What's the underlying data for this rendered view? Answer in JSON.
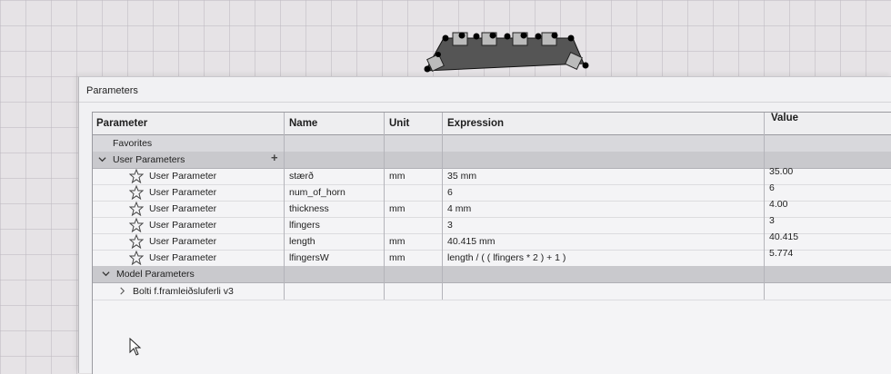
{
  "dialog": {
    "title": "Parameters"
  },
  "columns": {
    "parameter": "Parameter",
    "name": "Name",
    "unit": "Unit",
    "expression": "Expression",
    "value": "Value"
  },
  "favorites": {
    "label": "Favorites"
  },
  "user_parameters": {
    "label": "User Parameters",
    "add_icon": "plus-icon",
    "rows": [
      {
        "type": "User Parameter",
        "name": "stærð",
        "unit": "mm",
        "expression": "35 mm",
        "value": "35.00"
      },
      {
        "type": "User Parameter",
        "name": "num_of_horn",
        "unit": "",
        "expression": "6",
        "value": "6"
      },
      {
        "type": "User Parameter",
        "name": "thickness",
        "unit": "mm",
        "expression": "4 mm",
        "value": "4.00"
      },
      {
        "type": "User Parameter",
        "name": "lfingers",
        "unit": "",
        "expression": "3",
        "value": "3"
      },
      {
        "type": "User Parameter",
        "name": "length",
        "unit": "mm",
        "expression": "40.415 mm",
        "value": "40.415"
      },
      {
        "type": "User Parameter",
        "name": "lfingersW",
        "unit": "mm",
        "expression": "length / ( ( lfingers * 2 ) + 1 )",
        "value": "5.774"
      }
    ]
  },
  "model_parameters": {
    "label": "Model Parameters",
    "children": [
      {
        "label": "Bolti f.framleiðsluferli v3"
      }
    ]
  }
}
